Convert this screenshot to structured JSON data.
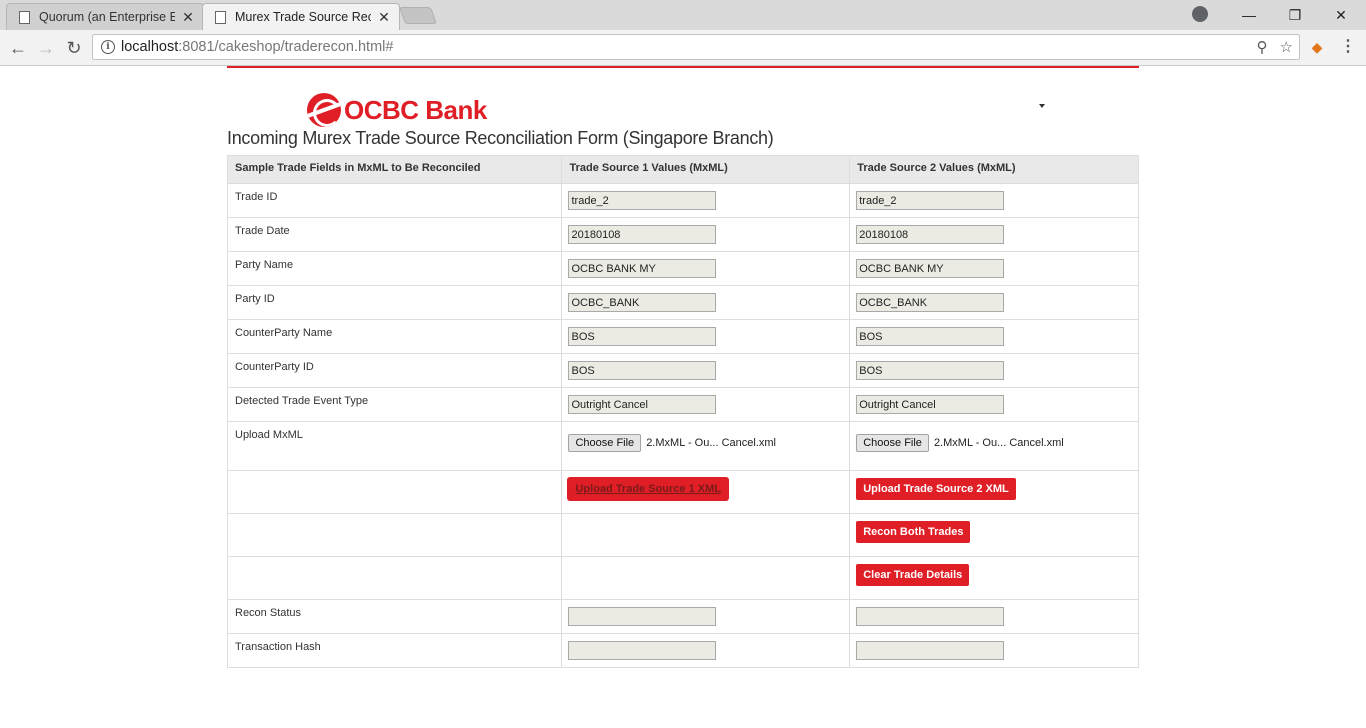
{
  "browser": {
    "tabs": [
      {
        "title": "Quorum (an Enterprise Et",
        "active": false
      },
      {
        "title": "Murex Trade Source Reco",
        "active": true
      }
    ],
    "url_host": "localhost",
    "url_path": ":8081/cakeshop/traderecon.html#"
  },
  "page": {
    "logo_text": "OCBC Bank",
    "form_title": "Incoming Murex Trade Source Reconciliation Form (Singapore Branch)",
    "headers": {
      "fields": "Sample Trade Fields in MxML to Be Reconciled",
      "source1": "Trade Source 1 Values (MxML)",
      "source2": "Trade Source 2 Values (MxML)"
    },
    "rows": [
      {
        "label": "Trade ID",
        "v1": "trade_2",
        "v2": "trade_2"
      },
      {
        "label": "Trade Date",
        "v1": "20180108",
        "v2": "20180108"
      },
      {
        "label": "Party Name",
        "v1": "OCBC BANK MY",
        "v2": "OCBC BANK MY"
      },
      {
        "label": "Party ID",
        "v1": "OCBC_BANK",
        "v2": "OCBC_BANK"
      },
      {
        "label": "CounterParty Name",
        "v1": "BOS",
        "v2": "BOS"
      },
      {
        "label": "CounterParty ID",
        "v1": "BOS",
        "v2": "BOS"
      },
      {
        "label": "Detected Trade Event Type",
        "v1": "Outright Cancel",
        "v2": "Outright Cancel"
      }
    ],
    "upload": {
      "label": "Upload MxML",
      "choose_label": "Choose File",
      "file1": "2.MxML - Ou... Cancel.xml",
      "file2": "2.MxML - Ou... Cancel.xml"
    },
    "buttons": {
      "upload1": "Upload Trade Source 1 XML",
      "upload2": "Upload Trade Source 2 XML",
      "recon": "Recon Both Trades",
      "clear": "Clear Trade Details"
    },
    "status_rows": {
      "recon_status": "Recon Status",
      "tx_hash": "Transaction Hash"
    }
  }
}
